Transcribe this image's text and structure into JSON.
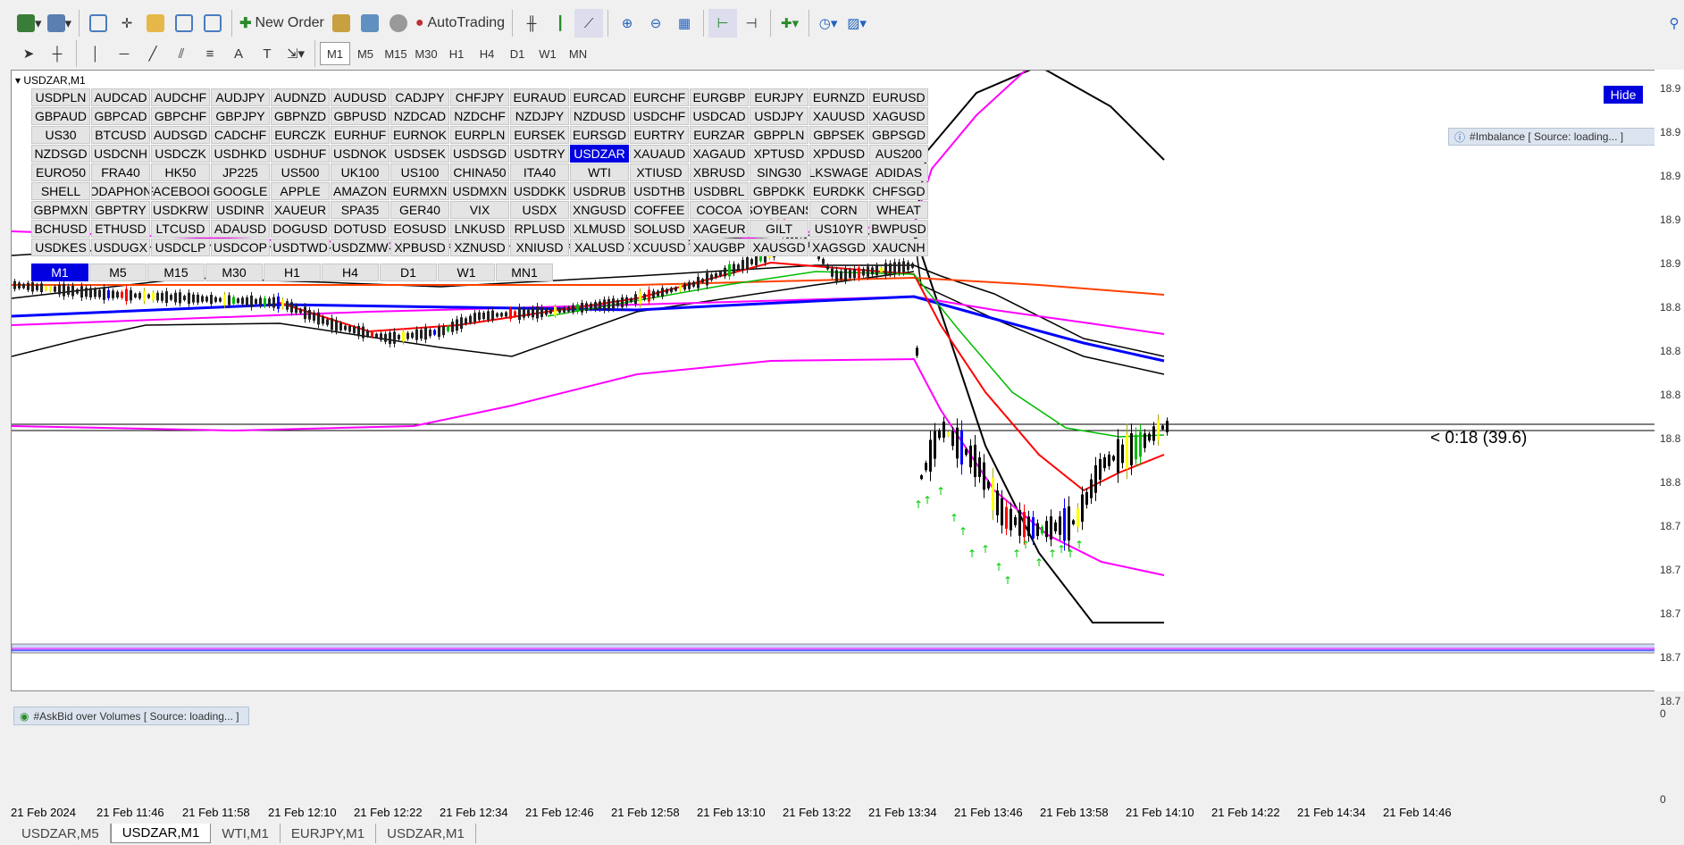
{
  "toolbar": {
    "new_order": "New Order",
    "autotrading": "AutoTrading",
    "timeframes": [
      "M1",
      "M5",
      "M15",
      "M30",
      "H1",
      "H4",
      "D1",
      "W1",
      "MN"
    ],
    "active_timeframe": "M1"
  },
  "chart": {
    "title": "USDZAR,M1",
    "hide_label": "Hide",
    "imbalance_label": "#Imbalance [ Source: loading... ]",
    "askbid_label": "#AskBid over Volumes [ Source: loading... ]",
    "timer": "< 0:18 (39.6)"
  },
  "symbols": [
    "USDPLN",
    "AUDCAD",
    "AUDCHF",
    "AUDJPY",
    "AUDNZD",
    "AUDUSD",
    "CADJPY",
    "CHFJPY",
    "EURAUD",
    "EURCAD",
    "EURCHF",
    "EURGBP",
    "EURJPY",
    "EURNZD",
    "EURUSD",
    "GBPAUD",
    "GBPCAD",
    "GBPCHF",
    "GBPJPY",
    "GBPNZD",
    "GBPUSD",
    "NZDCAD",
    "NZDCHF",
    "NZDJPY",
    "NZDUSD",
    "USDCHF",
    "USDCAD",
    "USDJPY",
    "XAUUSD",
    "XAGUSD",
    "US30",
    "BTCUSD",
    "AUDSGD",
    "CADCHF",
    "EURCZK",
    "EURHUF",
    "EURNOK",
    "EURPLN",
    "EURSEK",
    "EURSGD",
    "EURTRY",
    "EURZAR",
    "GBPPLN",
    "GBPSEK",
    "GBPSGD",
    "NZDSGD",
    "USDCNH",
    "USDCZK",
    "USDHKD",
    "USDHUF",
    "USDNOK",
    "USDSEK",
    "USDSGD",
    "USDTRY",
    "USDZAR",
    "XAUAUD",
    "XAGAUD",
    "XPTUSD",
    "XPDUSD",
    "AUS200",
    "EURO50",
    "FRA40",
    "HK50",
    "JP225",
    "US500",
    "UK100",
    "US100",
    "CHINA50",
    "ITA40",
    "WTI",
    "XTIUSD",
    "XBRUSD",
    "SING30",
    "LKSWAGE",
    "ADIDAS",
    "SHELL",
    "VODAPHONE",
    "FACEBOOK",
    "GOOGLE",
    "APPLE",
    "AMAZON",
    "EURMXN",
    "USDMXN",
    "USDDKK",
    "USDRUB",
    "USDTHB",
    "USDBRL",
    "GBPDKK",
    "EURDKK",
    "CHFSGD",
    "GBPMXN",
    "GBPTRY",
    "USDKRW",
    "USDINR",
    "XAUEUR",
    "SPA35",
    "GER40",
    "VIX",
    "USDX",
    "XNGUSD",
    "COFFEE",
    "COCOA",
    "SOYBEANS",
    "CORN",
    "WHEAT",
    "BCHUSD",
    "ETHUSD",
    "LTCUSD",
    "ADAUSD",
    "DOGUSD",
    "DOTUSD",
    "EOSUSD",
    "LNKUSD",
    "RPLUSD",
    "XLMUSD",
    "SOLUSD",
    "XAGEUR",
    "GILT",
    "US10YR",
    "BWPUSD",
    "USDKES",
    "USDUGX",
    "USDCLP",
    "USDCOP",
    "USDTWD",
    "USDZMW",
    "XPBUSD",
    "XZNUSD",
    "XNIUSD",
    "XALUSD",
    "XCUUSD",
    "XAUGBP",
    "XAUSGD",
    "XAGSGD",
    "XAUCNH"
  ],
  "selected_symbol": "USDZAR",
  "grid_timeframes": [
    "M1",
    "M5",
    "M15",
    "M30",
    "H1",
    "H4",
    "D1",
    "W1",
    "MN1"
  ],
  "price_labels": [
    "18.9",
    "18.9",
    "18.9",
    "18.9",
    "18.9",
    "18.8",
    "18.8",
    "18.8",
    "18.8",
    "18.8",
    "18.7",
    "18.7",
    "18.7",
    "18.7",
    "18.7"
  ],
  "time_labels": [
    "21 Feb 2024",
    "21 Feb 11:46",
    "21 Feb 11:58",
    "21 Feb 12:10",
    "21 Feb 12:22",
    "21 Feb 12:34",
    "21 Feb 12:46",
    "21 Feb 12:58",
    "21 Feb 13:10",
    "21 Feb 13:22",
    "21 Feb 13:34",
    "21 Feb 13:46",
    "21 Feb 13:58",
    "21 Feb 14:10",
    "21 Feb 14:22",
    "21 Feb 14:34",
    "21 Feb 14:46"
  ],
  "indicator_scale": [
    "0",
    "0"
  ],
  "tabs": [
    "USDZAR,M5",
    "USDZAR,M1",
    "WTI,M1",
    "EURJPY,M1",
    "USDZAR,M1"
  ],
  "active_tab": 1,
  "colors": {
    "selection": "#0000e0",
    "ma_black": "#000000",
    "ma_magenta": "#ff00ff",
    "ma_blue": "#0000ff",
    "ma_red": "#ff0000",
    "ma_green": "#00bb00",
    "ma_orange": "#ff4000"
  }
}
